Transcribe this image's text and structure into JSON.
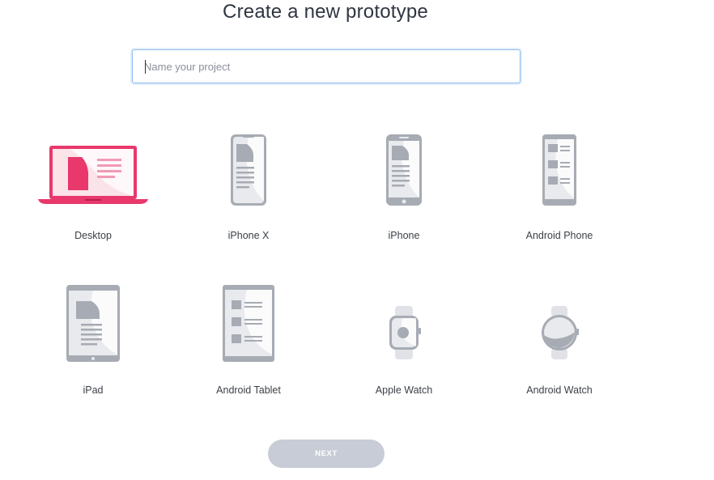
{
  "header": {
    "title": "Create a new prototype"
  },
  "project_name": {
    "value": "",
    "placeholder": "Name your project"
  },
  "devices": [
    {
      "label": "Desktop",
      "icon": "desktop-icon",
      "selected": true
    },
    {
      "label": "iPhone X",
      "icon": "iphone-x-icon",
      "selected": false
    },
    {
      "label": "iPhone",
      "icon": "iphone-icon",
      "selected": false
    },
    {
      "label": "Android Phone",
      "icon": "android-phone-icon",
      "selected": false
    },
    {
      "label": "iPad",
      "icon": "ipad-icon",
      "selected": false
    },
    {
      "label": "Android Tablet",
      "icon": "android-tablet-icon",
      "selected": false
    },
    {
      "label": "Apple Watch",
      "icon": "apple-watch-icon",
      "selected": false
    },
    {
      "label": "Android Watch",
      "icon": "android-watch-icon",
      "selected": false
    }
  ],
  "footer": {
    "next_label": "NEXT"
  },
  "colors": {
    "selected_accent": "#e8386c",
    "device_gray": "#a7abb3",
    "next_disabled": "#c8ccd6",
    "input_focus_border": "#8cbcec"
  }
}
